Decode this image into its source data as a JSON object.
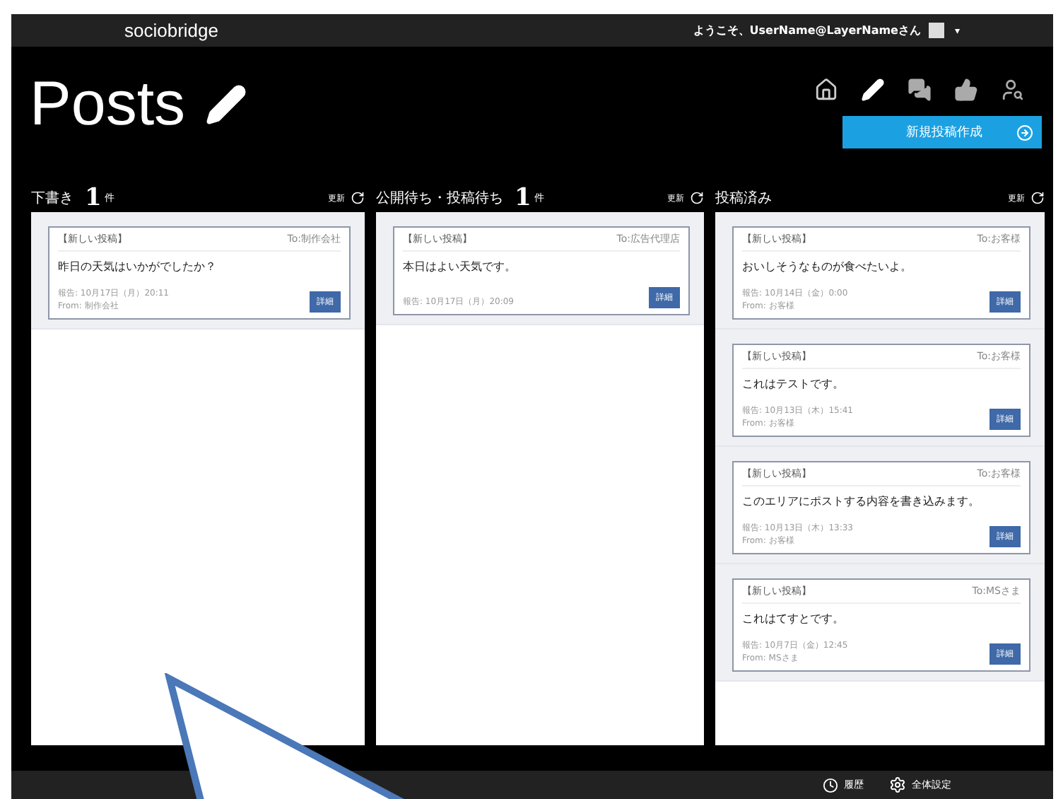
{
  "top_bar": {
    "logo": "sociobridge",
    "greeting": "ようこそ、UserName@LayerNameさん",
    "menu_caret": "▾"
  },
  "header": {
    "title": "Posts",
    "new_post_button": "新規投稿作成"
  },
  "columns": [
    {
      "title": "下書き",
      "count": "1",
      "count_unit": "件",
      "refresh": "更新",
      "cards": [
        {
          "tag": "【新しい投稿】",
          "to": "To:制作会社",
          "body": "昨日の天気はいかがでしたか？",
          "date": "報告: 10月17日（月）20:11",
          "from": "From: 制作会社",
          "button": "詳細"
        }
      ]
    },
    {
      "title": "公開待ち・投稿待ち",
      "count": "1",
      "count_unit": "件",
      "refresh": "更新",
      "cards": [
        {
          "tag": "【新しい投稿】",
          "to": "To:広告代理店",
          "body": "本日はよい天気です。",
          "date": "報告: 10月17日（月）20:09",
          "button": "詳細"
        }
      ]
    },
    {
      "title": "投稿済み",
      "refresh": "更新",
      "cards": [
        {
          "tag": "【新しい投稿】",
          "to": "To:お客様",
          "body": "おいしそうなものが食べたいよ。",
          "date": "報告: 10月14日（金）0:00",
          "from": "From: お客様",
          "button": "詳細"
        },
        {
          "tag": "【新しい投稿】",
          "to": "To:お客様",
          "body": "これはテストです。",
          "date": "報告: 10月13日（木）15:41",
          "from": "From: お客様",
          "button": "詳細"
        },
        {
          "tag": "【新しい投稿】",
          "to": "To:お客様",
          "body": "このエリアにポストする内容を書き込みます。",
          "date": "報告: 10月13日（木）13:33",
          "from": "From: お客様",
          "button": "詳細"
        },
        {
          "tag": "【新しい投稿】",
          "to": "To:MSさま",
          "body": "これはてすとです。",
          "date": "報告: 10月7日（金）12:45",
          "from": "From: MSさま",
          "button": "詳細"
        }
      ]
    }
  ],
  "footer": {
    "history": "履歴",
    "settings": "全体設定"
  }
}
